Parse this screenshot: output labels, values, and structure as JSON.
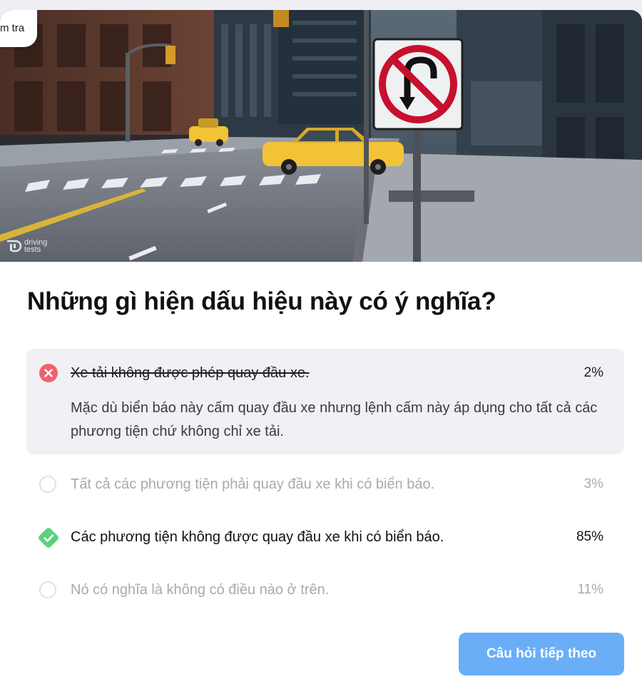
{
  "back_button": {
    "label": "m tra"
  },
  "hero": {
    "alt": "Biển báo cấm quay đầu xe trên đường phố",
    "watermark_line1": "driving",
    "watermark_line2": "tests",
    "sign_color": "#c8102e",
    "taxi_color": "#f2c237"
  },
  "question": {
    "text": "Những gì hiện dấu hiệu này có ý nghĩa?"
  },
  "answers": [
    {
      "text": "Xe tải không được phép quay đầu xe.",
      "percent": "2%",
      "state": "incorrect-selected",
      "icon": "x-circle-icon",
      "explanation": "Mặc dù biển báo này cấm quay đầu xe nhưng lệnh cấm này áp dụng cho tất cả các phương tiện chứ không chỉ xe tải."
    },
    {
      "text": "Tất cả các phương tiện phải quay đầu xe khi có biển báo.",
      "percent": "3%",
      "state": "unselected",
      "icon": "empty-circle-icon"
    },
    {
      "text": "Các phương tiện không được quay đầu xe khi có biển báo.",
      "percent": "85%",
      "state": "correct",
      "icon": "check-diamond-icon"
    },
    {
      "text": "Nó có nghĩa là không có điều nào ở trên.",
      "percent": "11%",
      "state": "unselected",
      "icon": "empty-circle-icon"
    }
  ],
  "next_button": {
    "label": "Câu hỏi tiếp theo"
  },
  "colors": {
    "incorrect": "#f0616f",
    "correct": "#5bd27a",
    "button": "#6aaef7",
    "highlight_bg": "#f1f1f5"
  }
}
